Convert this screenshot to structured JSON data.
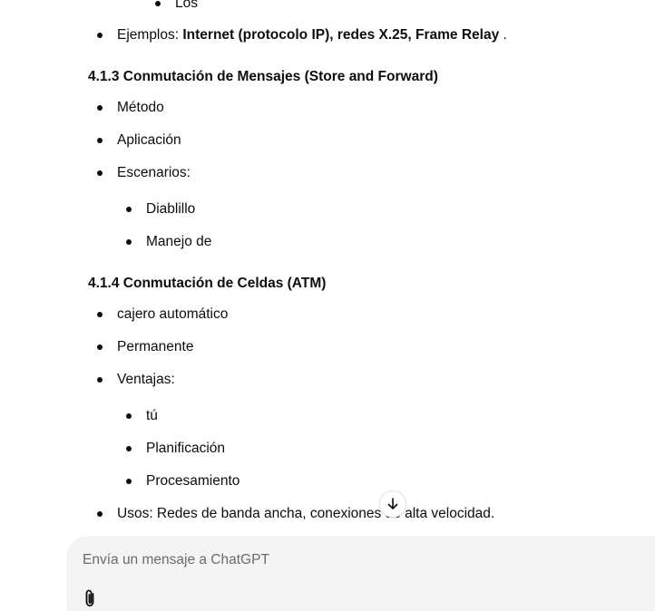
{
  "chat": {
    "items": [
      {
        "text": "Los"
      },
      {
        "prefix": "Ejemplos: ",
        "bold": "Internet (protocolo IP), redes X.25, Frame Relay",
        "suffix": " ."
      },
      {
        "heading": "4.1.3 Conmutación de Mensajes (Store and Forward)"
      },
      {
        "text": "Método"
      },
      {
        "text": "Aplicación"
      },
      {
        "text": "Escenarios:"
      },
      {
        "text": "Diablillo"
      },
      {
        "text": "Manejo de"
      },
      {
        "heading": "4.1.4 Conmutación de Celdas (ATM)"
      },
      {
        "text": "cajero automático"
      },
      {
        "text": "Permanente"
      },
      {
        "text": "Ventajas:"
      },
      {
        "text": "tú"
      },
      {
        "text": "Planificación"
      },
      {
        "text": "Procesamiento"
      },
      {
        "text": "Usos: Redes de banda ancha, conexiones de alta velocidad."
      }
    ]
  },
  "composer": {
    "placeholder": "Envía un mensaje a ChatGPT",
    "attach_icon": "paperclip-icon"
  },
  "scroll_button": {
    "icon": "arrow-down-icon"
  }
}
